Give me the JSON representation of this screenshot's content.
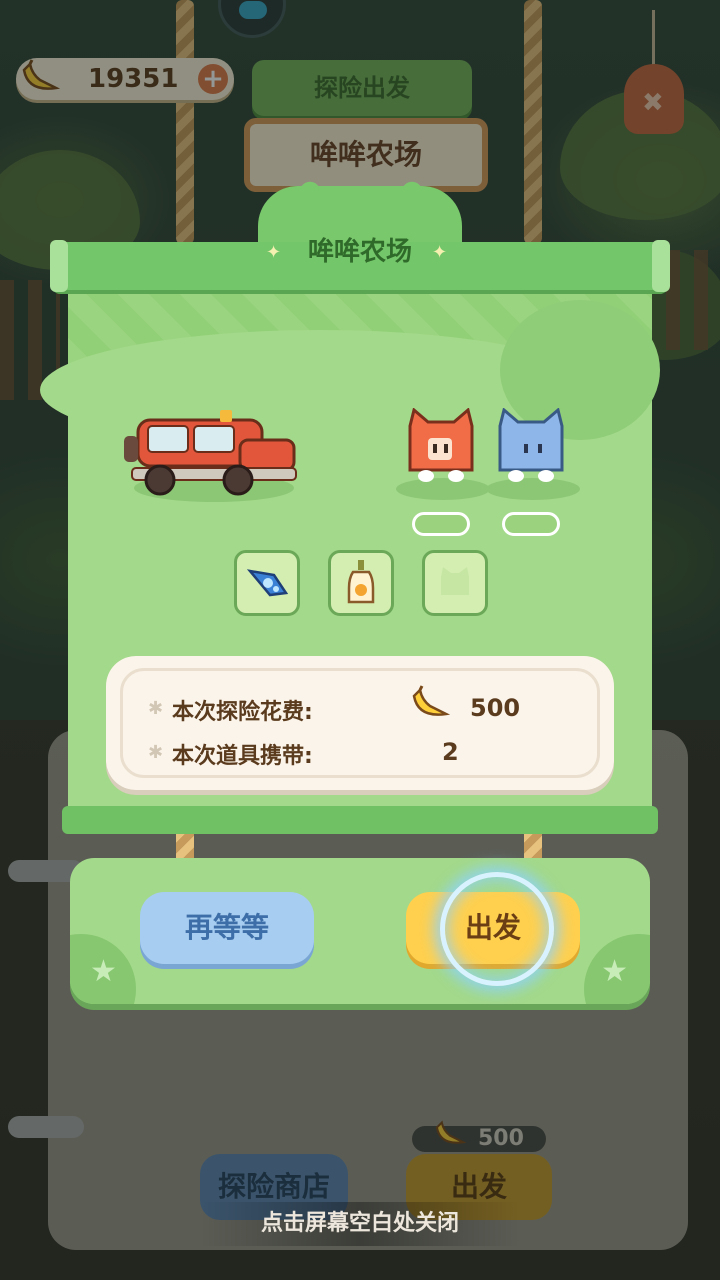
{
  "hud": {
    "banana_count": "19351",
    "plus_label": "+"
  },
  "background": {
    "ribbon_label": "探险出发",
    "farm_label": "哞哞农场",
    "back_shop_label": "探险商店",
    "back_go_label": "出发",
    "back_cost": "500"
  },
  "panel": {
    "title": "哞哞农场",
    "items": [
      {
        "name": "rocket-item",
        "icon": "rocket-icon"
      },
      {
        "name": "bottle-item",
        "icon": "bottle-icon"
      },
      {
        "name": "empty-slot",
        "icon": "cat-face-icon"
      }
    ],
    "info": {
      "cost_label": "本次探险花费:",
      "cost_value": "500",
      "items_label": "本次道具携带:",
      "items_value": "2"
    }
  },
  "actions": {
    "wait_label": "再等等",
    "go_label": "出发"
  },
  "footer": {
    "close_hint": "点击屏幕空白处关闭"
  },
  "colors": {
    "panel_green": "#a3d98a",
    "accent_yellow": "#ffd04e",
    "wait_blue": "#a7cdf0",
    "text_brown": "#5b3b1d"
  }
}
